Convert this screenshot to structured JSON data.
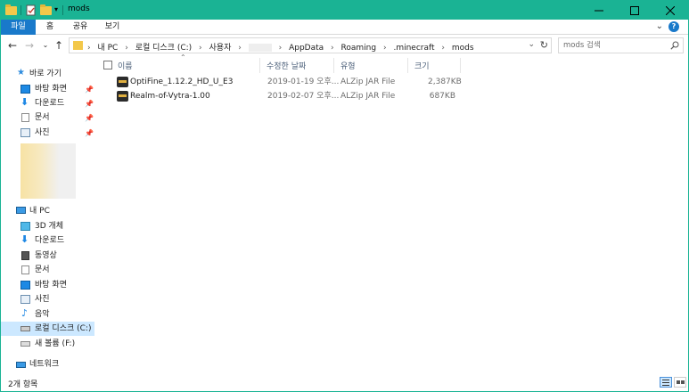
{
  "window": {
    "title": "mods"
  },
  "ribbon": {
    "tabs": [
      {
        "label": "파일"
      },
      {
        "label": "홈"
      },
      {
        "label": "공유"
      },
      {
        "label": "보기"
      }
    ],
    "help_label": "?"
  },
  "address": {
    "crumbs": [
      "내 PC",
      "로컬 디스크 (C:)",
      "사용자",
      "AppData",
      "Roaming",
      ".minecraft",
      "mods"
    ]
  },
  "search": {
    "placeholder": "mods 검색"
  },
  "navpane": {
    "quick_access": "바로 가기",
    "quick_items": [
      {
        "label": "바탕 화면",
        "icon": "desktop-icon"
      },
      {
        "label": "다운로드",
        "icon": "download-icon"
      },
      {
        "label": "문서",
        "icon": "document-icon"
      },
      {
        "label": "사진",
        "icon": "pictures-icon"
      }
    ],
    "this_pc": "내 PC",
    "pc_items": [
      {
        "label": "3D 개체",
        "icon": "3d-objects-icon"
      },
      {
        "label": "다운로드",
        "icon": "download-icon"
      },
      {
        "label": "동영상",
        "icon": "video-icon"
      },
      {
        "label": "문서",
        "icon": "document-icon"
      },
      {
        "label": "바탕 화면",
        "icon": "desktop-icon"
      },
      {
        "label": "사진",
        "icon": "pictures-icon"
      },
      {
        "label": "음악",
        "icon": "music-icon"
      },
      {
        "label": "로컬 디스크 (C:)",
        "icon": "local-disk-icon"
      },
      {
        "label": "새 볼륨 (F:)",
        "icon": "volume-icon"
      }
    ],
    "network": "네트워크"
  },
  "columns": {
    "name": "이름",
    "modified": "수정한 날짜",
    "type": "유형",
    "size": "크기"
  },
  "files": [
    {
      "name": "OptiFine_1.12.2_HD_U_E3",
      "modified": "2019-01-19 오후...",
      "type": "ALZip JAR File",
      "size": "2,387KB"
    },
    {
      "name": "Realm-of-Vytra-1.00",
      "modified": "2019-02-07 오후...",
      "type": "ALZip JAR File",
      "size": "687KB"
    }
  ],
  "status": {
    "item_count": "2개 항목"
  },
  "colors": {
    "accent": "#1ab394",
    "file_tab": "#1979ca",
    "selection": "#cce8ff"
  }
}
